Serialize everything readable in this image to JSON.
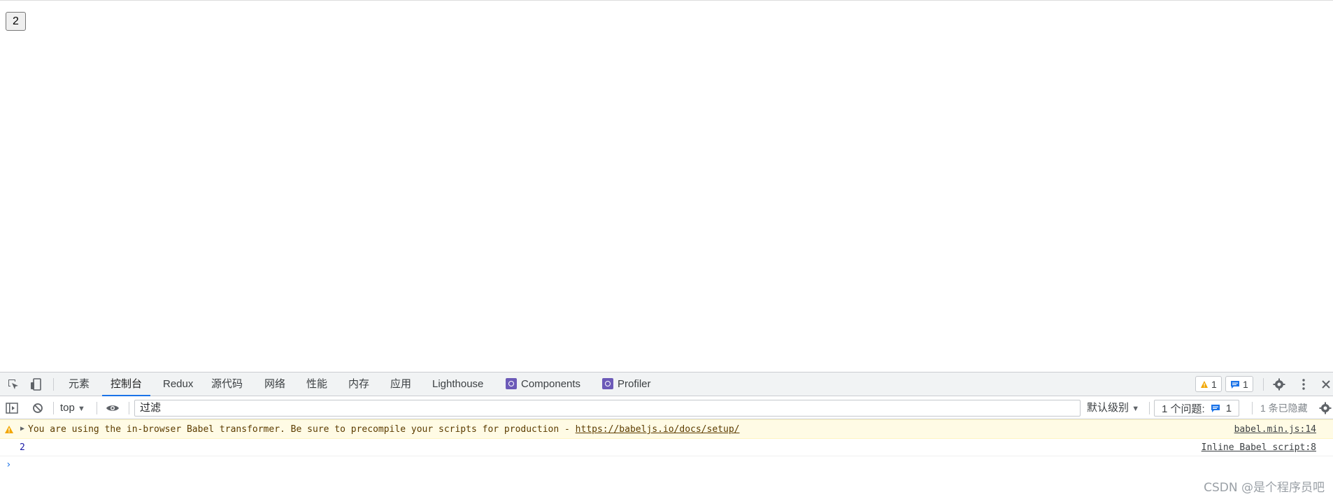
{
  "page": {
    "counter_button": "2"
  },
  "devtools": {
    "tabs": [
      {
        "label": "元素"
      },
      {
        "label": "控制台",
        "active": true
      },
      {
        "label": "Redux"
      },
      {
        "label": "源代码"
      },
      {
        "label": "网络"
      },
      {
        "label": "性能"
      },
      {
        "label": "内存"
      },
      {
        "label": "应用"
      },
      {
        "label": "Lighthouse"
      },
      {
        "label": "Components"
      },
      {
        "label": "Profiler"
      }
    ],
    "warnings_count": "1",
    "messages_count": "1",
    "toolbar": {
      "context": "top",
      "filter_placeholder": "过滤",
      "level": "默认级别",
      "issues_label": "1 个问题:",
      "issues_count": "1",
      "hidden": "1 条已隐藏"
    },
    "console": {
      "warning_text": "You are using the in-browser Babel transformer. Be sure to precompile your scripts for production - ",
      "warning_link": "https://babeljs.io/docs/setup/",
      "warning_source": "babel.min.js:14",
      "log_value": "2",
      "log_source": "Inline Babel script:8"
    },
    "colors": {
      "accent": "#1a73e8",
      "warning_bg": "#fffbe5",
      "warning_icon": "#f2a600"
    }
  },
  "watermark": "CSDN @是个程序员吧"
}
